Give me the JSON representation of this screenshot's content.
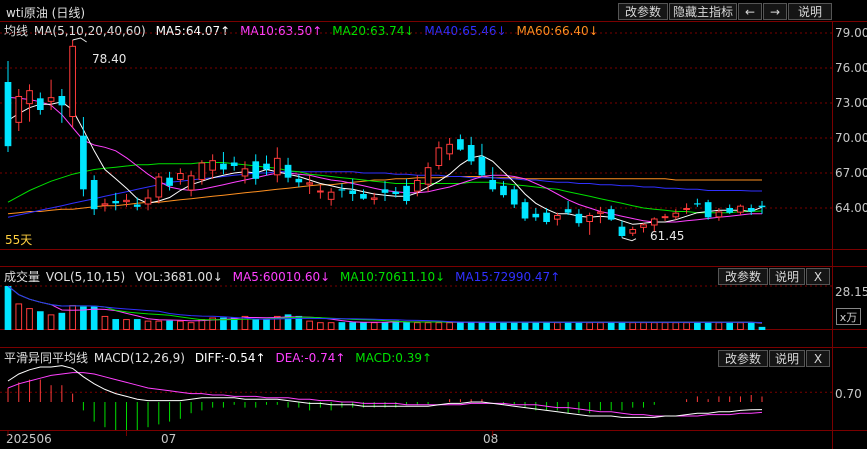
{
  "window": {
    "title": "wti原油 (日线)"
  },
  "toolbar": {
    "edit_params": "改参数",
    "hide_indicator": "隐藏主指标",
    "prev": "←",
    "next": "→",
    "help": "说明"
  },
  "main_panel": {
    "legend": {
      "name": "均线",
      "params": "MA(5,10,20,40,60)",
      "ma5": "MA5:64.07↑",
      "ma10": "MA10:63.50↑",
      "ma20": "MA20:63.74↓",
      "ma40": "MA40:65.46↓",
      "ma60": "MA60:66.40↓"
    },
    "y_ticks": [
      "79.00",
      "76.00",
      "73.00",
      "70.00",
      "67.00",
      "64.00"
    ],
    "high_label": "78.40",
    "low_label": "61.45",
    "ma_label": "55天"
  },
  "volume_panel": {
    "legend": {
      "name": "成交量",
      "params": "VOL(5,10,15)",
      "vol": "VOL:3681.00↓",
      "ma5": "MA5:60010.60↓",
      "ma10": "MA10:70611.10↓",
      "ma15": "MA15:72990.47↑"
    },
    "edit_params": "改参数",
    "help": "说明",
    "close": "X",
    "y_tick": "28.15",
    "unit": "x万"
  },
  "macd_panel": {
    "legend": {
      "name": "平滑异同平均线",
      "params": "MACD(12,26,9)",
      "diff": "DIFF:-0.54↑",
      "dea": "DEA:-0.74↑",
      "macd": "MACD:0.39↑"
    },
    "edit_params": "改参数",
    "help": "说明",
    "close": "X",
    "y_tick": "0.70"
  },
  "x_axis": {
    "labels": [
      "202506",
      "07",
      "08"
    ]
  },
  "colors": {
    "up": "#ff3b3b",
    "down": "#00e5ff",
    "ma5": "#ffffff",
    "ma10": "#ff40ff",
    "ma20": "#00e000",
    "ma40": "#3030ff",
    "ma60": "#ff9020",
    "grid": "#7a0000"
  },
  "chart_data": {
    "type": "candlestick",
    "ylim": [
      61,
      80
    ],
    "candles": [
      [
        74.8,
        76.6,
        68.8,
        69.3
      ],
      [
        71.3,
        74.2,
        70.6,
        73.6
      ],
      [
        72.9,
        74.6,
        71.4,
        74.1
      ],
      [
        73.4,
        73.9,
        72.0,
        72.4
      ],
      [
        73.1,
        75.0,
        72.4,
        73.5
      ],
      [
        73.6,
        74.2,
        71.3,
        72.8
      ],
      [
        71.8,
        78.4,
        70.9,
        77.9
      ],
      [
        70.2,
        71.8,
        65.0,
        65.6
      ],
      [
        66.4,
        66.8,
        63.4,
        63.9
      ],
      [
        64.2,
        64.8,
        63.7,
        64.4
      ],
      [
        64.6,
        65.3,
        63.8,
        64.4
      ],
      [
        64.5,
        65.2,
        64.1,
        64.7
      ],
      [
        64.3,
        64.9,
        63.8,
        64.1
      ],
      [
        64.3,
        65.6,
        63.8,
        64.9
      ],
      [
        64.9,
        67.0,
        64.4,
        66.7
      ],
      [
        66.6,
        67.1,
        65.5,
        65.9
      ],
      [
        66.4,
        67.4,
        66.0,
        67.0
      ],
      [
        65.5,
        67.2,
        65.0,
        66.8
      ],
      [
        66.4,
        68.1,
        66.0,
        67.9
      ],
      [
        67.2,
        68.6,
        66.5,
        68.1
      ],
      [
        67.8,
        68.8,
        66.9,
        67.3
      ],
      [
        67.9,
        68.4,
        67.2,
        67.6
      ],
      [
        66.7,
        68.0,
        66.1,
        67.4
      ],
      [
        68.0,
        68.6,
        66.0,
        66.5
      ],
      [
        67.8,
        68.5,
        66.8,
        67.3
      ],
      [
        66.8,
        69.2,
        66.2,
        68.3
      ],
      [
        67.7,
        68.3,
        66.2,
        66.6
      ],
      [
        66.5,
        66.9,
        65.8,
        66.2
      ],
      [
        66.0,
        66.8,
        65.2,
        66.2
      ],
      [
        65.4,
        66.0,
        64.8,
        65.5
      ],
      [
        64.7,
        65.7,
        64.2,
        65.4
      ],
      [
        65.6,
        66.1,
        64.9,
        65.5
      ],
      [
        65.5,
        66.5,
        64.6,
        65.2
      ],
      [
        65.2,
        65.6,
        64.7,
        64.8
      ],
      [
        64.7,
        65.3,
        64.3,
        64.9
      ],
      [
        65.6,
        66.3,
        64.6,
        65.3
      ],
      [
        65.4,
        65.8,
        64.9,
        65.2
      ],
      [
        65.9,
        66.5,
        64.3,
        64.6
      ],
      [
        65.4,
        66.8,
        65.0,
        66.4
      ],
      [
        66.0,
        67.9,
        65.4,
        67.5
      ],
      [
        67.6,
        69.7,
        67.3,
        69.2
      ],
      [
        68.6,
        70.0,
        68.1,
        69.5
      ],
      [
        69.9,
        70.3,
        68.9,
        69.0
      ],
      [
        69.4,
        70.1,
        67.7,
        68.0
      ],
      [
        68.4,
        69.5,
        66.7,
        66.8
      ],
      [
        66.4,
        67.5,
        65.4,
        65.6
      ],
      [
        65.9,
        66.3,
        64.9,
        65.1
      ],
      [
        65.6,
        65.9,
        64.0,
        64.3
      ],
      [
        64.5,
        64.8,
        62.9,
        63.1
      ],
      [
        63.5,
        64.0,
        62.9,
        63.2
      ],
      [
        63.6,
        64.0,
        62.6,
        62.8
      ],
      [
        63.0,
        63.6,
        62.5,
        63.4
      ],
      [
        63.9,
        64.6,
        63.4,
        63.6
      ],
      [
        63.5,
        63.9,
        62.4,
        62.7
      ],
      [
        62.8,
        63.6,
        61.7,
        63.4
      ],
      [
        63.5,
        64.1,
        62.7,
        63.7
      ],
      [
        63.9,
        64.2,
        62.9,
        63.0
      ],
      [
        62.4,
        62.9,
        61.45,
        61.6
      ],
      [
        61.8,
        62.4,
        61.6,
        62.2
      ],
      [
        62.3,
        62.7,
        61.9,
        62.6
      ],
      [
        62.5,
        63.2,
        62.0,
        63.1
      ],
      [
        63.2,
        63.5,
        62.9,
        63.3
      ],
      [
        63.2,
        63.9,
        63.0,
        63.6
      ],
      [
        63.9,
        64.4,
        63.5,
        64.0
      ],
      [
        64.4,
        64.8,
        64.1,
        64.3
      ],
      [
        64.5,
        64.7,
        63.0,
        63.2
      ],
      [
        63.2,
        64.0,
        62.9,
        63.7
      ],
      [
        64.0,
        64.3,
        63.5,
        63.6
      ],
      [
        63.6,
        64.3,
        63.4,
        64.2
      ],
      [
        64.0,
        64.3,
        63.4,
        63.7
      ],
      [
        64.2,
        64.6,
        63.5,
        64.07
      ]
    ],
    "ma5": [
      71.5,
      72.1,
      72.6,
      72.9,
      72.9,
      73.1,
      72.4,
      70.7,
      68.9,
      67.3,
      66.5,
      65.7,
      64.8,
      64.4,
      64.6,
      64.9,
      65.5,
      66.0,
      66.3,
      66.6,
      66.8,
      67.0,
      67.1,
      67.0,
      67.3,
      67.1,
      66.9,
      66.7,
      66.4,
      66.1,
      65.9,
      65.7,
      65.6,
      65.4,
      65.2,
      65.1,
      65.0,
      65.0,
      65.3,
      65.8,
      66.3,
      66.9,
      67.7,
      68.3,
      68.5,
      68.0,
      67.1,
      66.2,
      65.2,
      64.4,
      63.9,
      63.5,
      63.5,
      63.3,
      63.2,
      63.3,
      63.2,
      62.9,
      62.6,
      62.7,
      62.8,
      62.8,
      63.0,
      63.3,
      63.6,
      63.7,
      63.8,
      63.8,
      63.8,
      63.7,
      64.07
    ],
    "ma10": [
      73.5,
      73.4,
      73.3,
      73.1,
      72.8,
      72.0,
      70.9,
      69.8,
      69.4,
      69.2,
      68.9,
      68.3,
      67.6,
      66.9,
      66.3,
      65.8,
      65.6,
      65.5,
      65.6,
      65.8,
      66.0,
      66.2,
      66.4,
      66.6,
      66.8,
      67.0,
      67.0,
      66.9,
      66.8,
      66.6,
      66.4,
      66.3,
      66.1,
      65.9,
      65.7,
      65.5,
      65.4,
      65.3,
      65.3,
      65.4,
      65.6,
      65.8,
      66.1,
      66.4,
      66.7,
      66.8,
      66.8,
      66.7,
      66.5,
      66.1,
      65.7,
      65.2,
      64.7,
      64.3,
      64.0,
      63.7,
      63.5,
      63.3,
      63.1,
      62.9,
      62.8,
      62.8,
      62.8,
      62.9,
      63.0,
      63.1,
      63.2,
      63.3,
      63.4,
      63.5,
      63.5
    ],
    "ma20": [
      64.5,
      65.0,
      65.5,
      65.9,
      66.3,
      66.6,
      66.9,
      67.1,
      67.3,
      67.4,
      67.5,
      67.6,
      67.7,
      67.7,
      67.8,
      67.8,
      67.8,
      67.8,
      67.9,
      67.9,
      67.9,
      67.8,
      67.7,
      67.6,
      67.5,
      67.4,
      67.2,
      67.1,
      66.9,
      66.8,
      66.7,
      66.6,
      66.5,
      66.4,
      66.3,
      66.2,
      66.1,
      66.1,
      66.1,
      66.1,
      66.1,
      66.1,
      66.1,
      66.2,
      66.2,
      66.2,
      66.1,
      66.0,
      65.9,
      65.8,
      65.7,
      65.6,
      65.4,
      65.2,
      65.0,
      64.8,
      64.6,
      64.4,
      64.2,
      64.0,
      63.9,
      63.8,
      63.7,
      63.7,
      63.6,
      63.6,
      63.6,
      63.6,
      63.7,
      63.7,
      63.74
    ],
    "ma40": [
      63.2,
      63.4,
      63.6,
      63.8,
      64.0,
      64.2,
      64.4,
      64.6,
      64.8,
      65.0,
      65.2,
      65.4,
      65.6,
      65.8,
      66.0,
      66.2,
      66.3,
      66.4,
      66.5,
      66.6,
      66.7,
      66.8,
      66.9,
      67.0,
      67.0,
      67.1,
      67.1,
      67.1,
      67.1,
      67.1,
      67.1,
      67.1,
      67.1,
      67.0,
      67.0,
      67.0,
      66.9,
      66.9,
      66.8,
      66.8,
      66.8,
      66.7,
      66.7,
      66.6,
      66.6,
      66.6,
      66.5,
      66.5,
      66.4,
      66.4,
      66.3,
      66.2,
      66.2,
      66.1,
      66.1,
      66.0,
      66.0,
      65.9,
      65.9,
      65.8,
      65.8,
      65.7,
      65.7,
      65.6,
      65.6,
      65.5,
      65.5,
      65.5,
      65.5,
      65.46,
      65.46
    ],
    "ma60": [
      63.5,
      63.6,
      63.7,
      63.7,
      63.8,
      63.9,
      63.9,
      64.0,
      64.1,
      64.2,
      64.2,
      64.3,
      64.4,
      64.5,
      64.5,
      64.6,
      64.7,
      64.8,
      64.9,
      65.0,
      65.1,
      65.2,
      65.3,
      65.4,
      65.5,
      65.6,
      65.7,
      65.8,
      65.9,
      66.0,
      66.0,
      66.1,
      66.2,
      66.3,
      66.4,
      66.4,
      66.5,
      66.5,
      66.6,
      66.6,
      66.6,
      66.7,
      66.7,
      66.7,
      66.7,
      66.6,
      66.6,
      66.6,
      66.5,
      66.5,
      66.5,
      66.5,
      66.5,
      66.5,
      66.5,
      66.5,
      66.5,
      66.5,
      66.5,
      66.5,
      66.5,
      66.5,
      66.4,
      66.4,
      66.4,
      66.4,
      66.4,
      66.4,
      66.4,
      66.4,
      66.4
    ],
    "volume": [
      28.15,
      17,
      14,
      12,
      10,
      11,
      16,
      15,
      15,
      9,
      7,
      7,
      7,
      6,
      6,
      6,
      6,
      5,
      7,
      8,
      8,
      8,
      9,
      7,
      7,
      9,
      10,
      9,
      6,
      5,
      5,
      5,
      5,
      5,
      5,
      5,
      6,
      5,
      5,
      5,
      5,
      5,
      5,
      5,
      5,
      5,
      5,
      5,
      5,
      5,
      5,
      5,
      5,
      5,
      5,
      5,
      5,
      5,
      5,
      5,
      5,
      5,
      5,
      5,
      5,
      5,
      5,
      5,
      5,
      5,
      2
    ],
    "macd_diff": [
      1.5,
      2.0,
      2.3,
      2.5,
      2.5,
      2.6,
      2.4,
      1.8,
      1.3,
      0.9,
      0.6,
      0.4,
      0.2,
      0.1,
      0.1,
      0.1,
      0.1,
      0.2,
      0.3,
      0.3,
      0.3,
      0.3,
      0.2,
      0.2,
      0.2,
      0.2,
      0.1,
      0.0,
      -0.1,
      -0.1,
      -0.2,
      -0.2,
      -0.2,
      -0.3,
      -0.3,
      -0.3,
      -0.3,
      -0.3,
      -0.3,
      -0.3,
      -0.2,
      -0.1,
      -0.1,
      0.0,
      0.0,
      -0.1,
      -0.2,
      -0.3,
      -0.4,
      -0.5,
      -0.6,
      -0.7,
      -0.8,
      -0.9,
      -1.0,
      -1.0,
      -1.0,
      -1.1,
      -1.1,
      -1.1,
      -1.1,
      -1.0,
      -1.0,
      -0.9,
      -0.8,
      -0.8,
      -0.7,
      -0.7,
      -0.6,
      -0.55,
      -0.54
    ],
    "macd_dea": [
      1.0,
      1.3,
      1.5,
      1.7,
      1.9,
      2.0,
      2.1,
      2.1,
      2.0,
      1.8,
      1.6,
      1.4,
      1.2,
      1.0,
      0.9,
      0.8,
      0.7,
      0.6,
      0.6,
      0.5,
      0.5,
      0.4,
      0.4,
      0.4,
      0.3,
      0.3,
      0.3,
      0.2,
      0.2,
      0.1,
      0.1,
      0.0,
      0.0,
      -0.1,
      -0.1,
      -0.1,
      -0.1,
      -0.2,
      -0.2,
      -0.2,
      -0.2,
      -0.2,
      -0.2,
      -0.1,
      -0.1,
      -0.1,
      -0.1,
      -0.2,
      -0.2,
      -0.2,
      -0.3,
      -0.4,
      -0.4,
      -0.5,
      -0.6,
      -0.7,
      -0.7,
      -0.8,
      -0.9,
      -0.9,
      -1.0,
      -1.0,
      -1.0,
      -1.0,
      -1.0,
      -0.9,
      -0.9,
      -0.9,
      -0.8,
      -0.8,
      -0.74
    ],
    "macd_hist": [
      1.0,
      1.4,
      1.6,
      1.6,
      1.2,
      1.2,
      0.6,
      -0.6,
      -1.4,
      -1.8,
      -2.0,
      -2.0,
      -2.0,
      -1.8,
      -1.6,
      -1.4,
      -1.2,
      -0.8,
      -0.6,
      -0.4,
      -0.4,
      -0.2,
      -0.4,
      -0.4,
      -0.2,
      -0.2,
      -0.4,
      -0.4,
      -0.6,
      -0.4,
      -0.6,
      -0.4,
      -0.4,
      -0.4,
      -0.4,
      -0.4,
      -0.4,
      -0.2,
      -0.2,
      -0.2,
      0.0,
      0.2,
      0.2,
      0.2,
      0.2,
      0.0,
      -0.2,
      -0.2,
      -0.4,
      -0.6,
      -0.6,
      -0.6,
      -0.8,
      -0.8,
      -0.8,
      -0.6,
      -0.6,
      -0.6,
      -0.4,
      -0.4,
      -0.2,
      0.0,
      0.0,
      0.2,
      0.4,
      0.2,
      0.4,
      0.4,
      0.4,
      0.5,
      0.39
    ]
  }
}
